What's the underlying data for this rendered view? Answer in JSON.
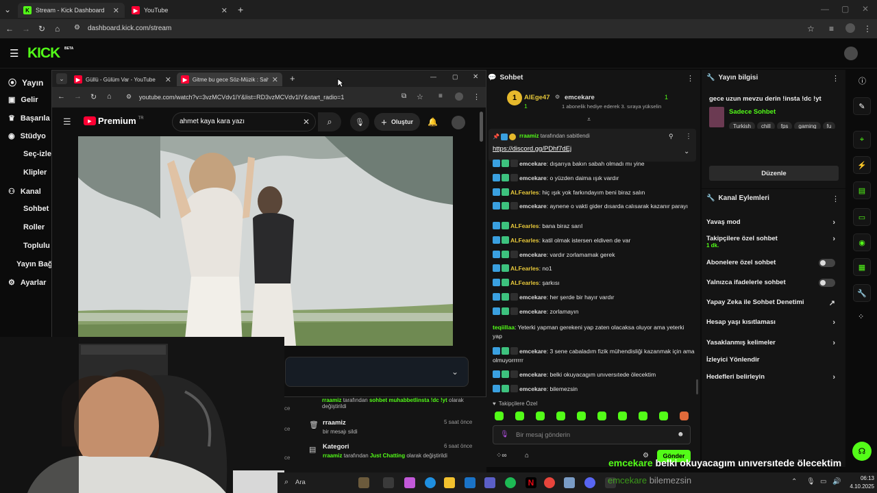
{
  "outer_tabs": [
    {
      "title": "Stream - Kick Dashboard"
    },
    {
      "title": "YouTube"
    }
  ],
  "outer_url": "dashboard.kick.com/stream",
  "kick": {
    "logo": "KICK",
    "logo_sup": "BETA",
    "nav": [
      "Yayın",
      "Gelir",
      "Başarıla",
      "Stüdyo",
      "Seç-izle",
      "Klipler",
      "Kanal",
      "Sohbet",
      "Roller",
      "Toplulu",
      "Yayın Bağ",
      "Ayarlar"
    ]
  },
  "yt": {
    "tabs": [
      "Güllü - Gülüm Var - YouTube",
      "Gitme bu gece Söz-Müzik : Sah"
    ],
    "url": "youtube.com/watch?v=3vzMCVdv1lY&list=RD3vzMCVdv1lY&start_radio=1",
    "logo": "Premium",
    "logo_sup": "TR",
    "search_value": "ahmet kaya kara yazı",
    "create_label": "Oluştur"
  },
  "chat": {
    "title": "Sohbet",
    "top_user": "AlEge47",
    "top_count": "1",
    "top_sub": "1",
    "leader_name": "emcekare",
    "leader_count": "1",
    "leader_sub": "1 abonelik hediye ederek 3. sıraya yükselin",
    "pinned_by": "rraamiz",
    "pinned_suffix": "tarafından sabitlendi",
    "pinned_link": "https://discord.gg/PDhf7dEj",
    "messages": [
      {
        "user": "emcekare",
        "text": "dışarıya bakın sabah olmadı mı yine",
        "color": "white"
      },
      {
        "user": "emcekare",
        "text": "o yüzden daima ışık vardır",
        "color": "white"
      },
      {
        "user": "ALFearles",
        "text": "hiç ışık yok farkındayım beni biraz salın",
        "color": "yellow"
      },
      {
        "user": "emcekare",
        "text": "aynene o vakti gider dısarda calısarak kazanır parayı",
        "color": "white"
      },
      {
        "user": "ALFearles",
        "text": "bana biraz sarıl",
        "color": "yellow"
      },
      {
        "user": "ALFearles",
        "text": "katil olmak istersen eldiven de var",
        "color": "yellow"
      },
      {
        "user": "emcekare",
        "text": "vardır zorlamamak gerek",
        "color": "white"
      },
      {
        "user": "ALFearles",
        "text": "no1",
        "color": "yellow"
      },
      {
        "user": "ALFearles",
        "text": "şarkısı",
        "color": "yellow"
      },
      {
        "user": "emcekare",
        "text": "her şerde bir hayır vardır",
        "color": "white"
      },
      {
        "user": "emcekare",
        "text": "zorlamayın",
        "color": "white"
      },
      {
        "user": "teqiillaa",
        "text": "Yeterki yapman gerekeni yap zaten olacaksa oluyor ama yeterki yap",
        "color": "green"
      },
      {
        "user": "emcekare",
        "text": "3 sene cabaladım fizik mühendisliği kazanmak için ama olmuyorrrrrr",
        "color": "white"
      },
      {
        "user": "emcekare",
        "text": "belki okuyacagım unıversıtede ölecektim",
        "color": "white"
      },
      {
        "user": "emcekare",
        "text": "bilemezsin",
        "color": "white"
      }
    ],
    "followers_label": "Takipçilere Özel",
    "input_placeholder": "Bir mesaj gönderin",
    "send_label": "Gönder",
    "overlay_user": "emcekare",
    "overlay_text": "belki okuyacagım unıversıtede ölecektim",
    "overlay2_user": "emcekare",
    "overlay2_text": "bilemezsin"
  },
  "activity": [
    {
      "user": "rraamiz",
      "text1": "tarafından",
      "text2": "sohbet muhabbetlinsta !dc !yt",
      "text3": "olarak değiştirildi",
      "time": ""
    },
    {
      "user": "rraamiz",
      "text1": "bir mesajı sildi",
      "text2": "",
      "text3": "",
      "time": "5 saat önce"
    },
    {
      "user": "Kategori",
      "text1": "tarafından",
      "text2": "Just Chatting",
      "text3": "olarak değiştirildi",
      "by": "rraamiz",
      "time": "6 saat önce"
    }
  ],
  "info": {
    "title": "Yayın bilgisi",
    "stream_title": "gece uzun mevzu derin !insta !dc !yt",
    "category": "Sadece Sohbet",
    "tags": [
      "Turkish",
      "chill",
      "fps",
      "gaming",
      "fu"
    ],
    "edit_label": "Düzenle",
    "actions_title": "Kanal Eylemleri",
    "actions": [
      {
        "label": "Yavaş mod",
        "kind": "chevron",
        "sub": ""
      },
      {
        "label": "Takipçilere özel sohbet",
        "kind": "chevron",
        "sub": "1 dk."
      },
      {
        "label": "Abonelere özel sohbet",
        "kind": "toggle",
        "sub": ""
      },
      {
        "label": "Yalnızca ifadelerle sohbet",
        "kind": "toggle",
        "sub": ""
      },
      {
        "label": "Yapay Zeka ile Sohbet Denetimi",
        "kind": "external",
        "sub": ""
      },
      {
        "label": "Hesap yaşı kısıtlaması",
        "kind": "chevron",
        "sub": ""
      },
      {
        "label": "Yasaklanmış kelimeler",
        "kind": "chevron",
        "sub": ""
      },
      {
        "label": "İzleyici Yönlendir",
        "kind": "none",
        "sub": ""
      },
      {
        "label": "Hedefleri belirleyin",
        "kind": "chevron",
        "sub": ""
      }
    ]
  },
  "taskbar": {
    "search": "Ara",
    "time": "06:13",
    "date": "4.10.2025"
  },
  "colors": {
    "kick_green": "#53fc18",
    "yt_red": "#ff0033"
  }
}
